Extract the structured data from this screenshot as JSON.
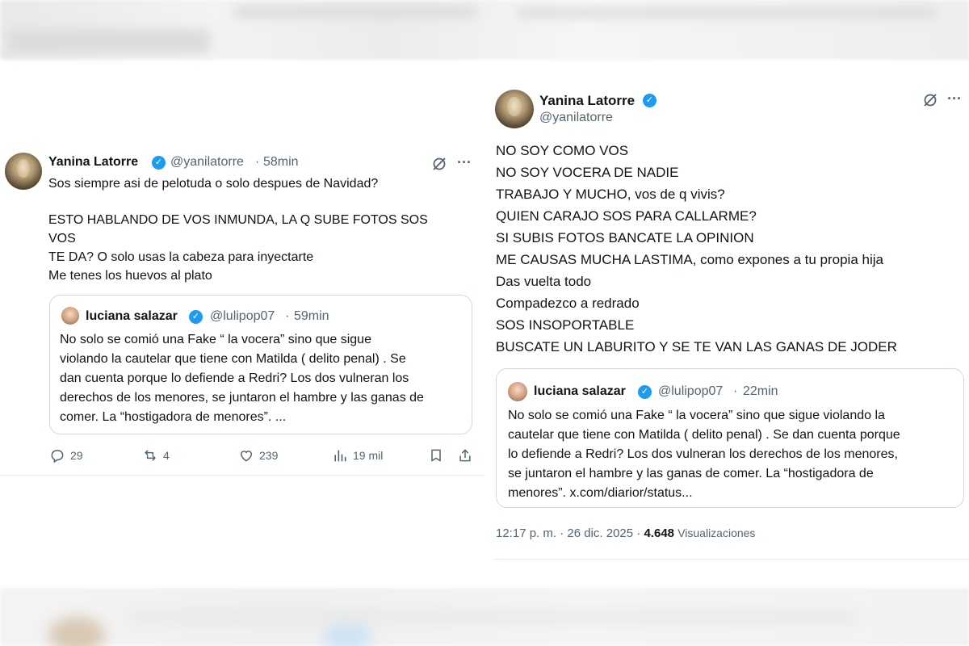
{
  "left_tweet": {
    "author_name": "Yanina Latorre",
    "author_handle": "@yanilatorre",
    "time": "58min",
    "more": "···",
    "body_lines": [
      "Sos siempre asi de pelotuda o solo despues de  Navidad?",
      "",
      "ESTO HABLANDO DE VOS INMUNDA, LA Q SUBE FOTOS SOS",
      "VOS",
      "TE DA? O solo usas la cabeza para inyectarte",
      "Me tenes los huevos al plato"
    ],
    "quote": {
      "author_name": "luciana salazar",
      "author_handle": "@lulipop07",
      "time": "59min",
      "text_lines": [
        "No solo se comió una Fake “ la vocera” sino que sigue",
        "violando la cautelar que tiene con Matilda ( delito penal) . Se",
        "dan cuenta porque lo defiende a Redri?  Los dos vulneran los",
        "derechos de los menores, se juntaron el hambre y las ganas de",
        "comer. La “hostigadora de menores”. ..."
      ]
    },
    "actions": {
      "replies": "29",
      "reposts": "4",
      "likes": "239",
      "views": "19 mil"
    }
  },
  "right_tweet": {
    "author_name": "Yanina Latorre",
    "author_handle": "@yanilatorre",
    "body_lines": [
      "NO SOY COMO VOS",
      "NO SOY VOCERA DE NADIE",
      "TRABAJO Y MUCHO, vos de q vivis?",
      "QUIEN CARAJO SOS PARA CALLARME?",
      "SI SUBIS FOTOS BANCATE LA OPINION",
      " ME CAUSAS MUCHA LASTIMA, como expones a tu propia hija",
      "Das vuelta todo",
      "Compadezco a redrado",
      "SOS INSOPORTABLE",
      "BUSCATE UN LABURITO Y SE TE VAN LAS GANAS DE JODER"
    ],
    "quote": {
      "author_name": "luciana salazar",
      "author_handle": "@lulipop07",
      "time": "22min",
      "text_lines": [
        "No solo se comió una Fake “ la vocera” sino que sigue violando la",
        "cautelar que tiene con Matilda ( delito penal) . Se dan cuenta porque",
        "lo defiende a Redri?  Los dos vulneran los derechos de los menores,",
        "se juntaron el hambre y las ganas de comer. La “hostigadora de",
        "menores”. x.com/diarior/status..."
      ]
    },
    "footer": {
      "time": "12:17 p. m.",
      "date": "26 dic. 2025",
      "views_count": "4.648",
      "views_label": "Visualizaciones"
    }
  },
  "colors": {
    "text": "#0f1419",
    "secondary": "#536471",
    "verified": "#1d9bf0",
    "border": "#cfd9de"
  },
  "icons": {
    "grok": "grok-icon",
    "more": "more-icon",
    "reply": "reply-icon",
    "repost": "repost-icon",
    "like": "like-icon",
    "views": "views-icon",
    "bookmark": "bookmark-icon",
    "share": "share-icon",
    "verified": "verified-badge-icon"
  }
}
